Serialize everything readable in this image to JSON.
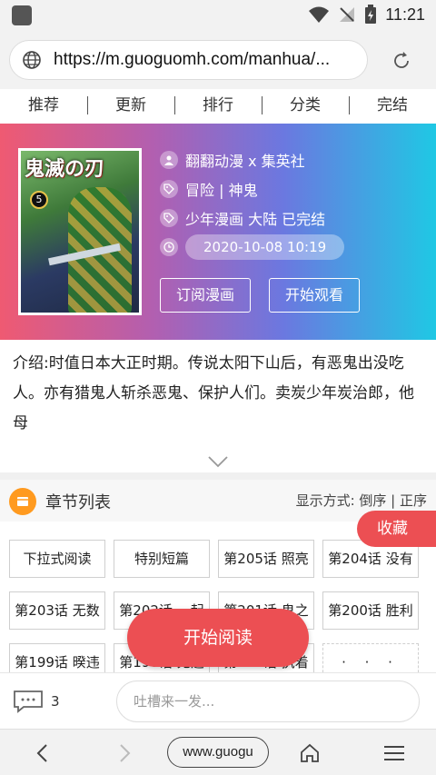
{
  "status": {
    "time": "11:21"
  },
  "browser": {
    "url": "https://m.guoguomh.com/manhua/...",
    "bottom_address": "www.guogu"
  },
  "nav_tabs": [
    {
      "label": "推荐"
    },
    {
      "label": "更新"
    },
    {
      "label": "排行"
    },
    {
      "label": "分类"
    },
    {
      "label": "完结"
    }
  ],
  "comic": {
    "cover_title": "鬼滅の刃",
    "cover_volume": "5",
    "publisher": "翻翻动漫 x 集英社",
    "genres": "冒险 | 神鬼",
    "tags": "少年漫画 大陆 已完结",
    "updated": "2020-10-08 10:19",
    "subscribe_label": "订阅漫画",
    "start_watch_label": "开始观看",
    "intro": "介绍:时值日本大正时期。传说太阳下山后，有恶鬼出没吃人。亦有猎鬼人斩杀恶鬼、保护人们。卖炭少年炭治郎，他母"
  },
  "chapters": {
    "title": "章节列表",
    "sort_label": "显示方式: 倒序 | 正序",
    "favorite_label": "收藏",
    "start_read_label": "开始阅读",
    "items": [
      {
        "label": "下拉式阅读"
      },
      {
        "label": "特别短篇"
      },
      {
        "label": "第205话 照亮"
      },
      {
        "label": "第204话 没有"
      },
      {
        "label": "第203话 无数"
      },
      {
        "label": "第202话 一起"
      },
      {
        "label": "第201话 鬼之"
      },
      {
        "label": "第200话 胜利"
      },
      {
        "label": "第199话 暌违"
      },
      {
        "label": "第198话 无违"
      },
      {
        "label": "第197话 执着"
      },
      {
        "label": "· · ·"
      }
    ]
  },
  "comments": {
    "count": "3",
    "placeholder": "吐槽来一发..."
  },
  "colors": {
    "accent": "#ec4f53",
    "chapter_icon": "#ff9a1f"
  }
}
